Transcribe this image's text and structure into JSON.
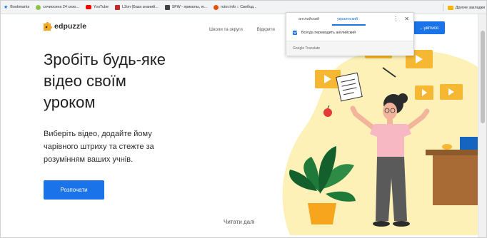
{
  "bookmarks": {
    "items": [
      {
        "label": "Bookmarks",
        "icon": "star-icon",
        "color": "#1a73e8"
      },
      {
        "label": "сочиоснна 24 сезо...",
        "icon": "favicon-green",
        "color": "#8bc34a"
      },
      {
        "label": "YouTube",
        "icon": "youtube-icon",
        "color": "#ff0000"
      },
      {
        "label": "L2on (База знаний...",
        "icon": "favicon-red",
        "color": "#c62828"
      },
      {
        "label": "SFW - приколы, ю...",
        "icon": "favicon-dark",
        "color": "#424242"
      },
      {
        "label": "rutor.info :: Свобод...",
        "icon": "favicon-orange",
        "color": "#e65100"
      }
    ],
    "other": {
      "label": "Другие закладки",
      "color": "#f4b400"
    }
  },
  "site": {
    "logo_text": "edpuzzle",
    "nav": [
      "Школи та округи",
      "Відкрити"
    ],
    "top_cta": "…увітися",
    "hero_title_lines": [
      "Зробіть будь-яке",
      "відео своїм",
      "уроком"
    ],
    "hero_sub": "Виберіть відео, додайте йому чарівного штриху та стежте за розумінням ваших учнів.",
    "start_button": "Розпочати",
    "read_more": "Читати далі"
  },
  "translate": {
    "tabs": [
      "английский",
      "украинский"
    ],
    "active_tab": 1,
    "checkbox_label": "Всегда переводить английский",
    "checkbox_checked": true,
    "footer": "Google Translate"
  },
  "colors": {
    "accent": "#1a73e8",
    "illustration_yellow": "#fdf1b8"
  }
}
